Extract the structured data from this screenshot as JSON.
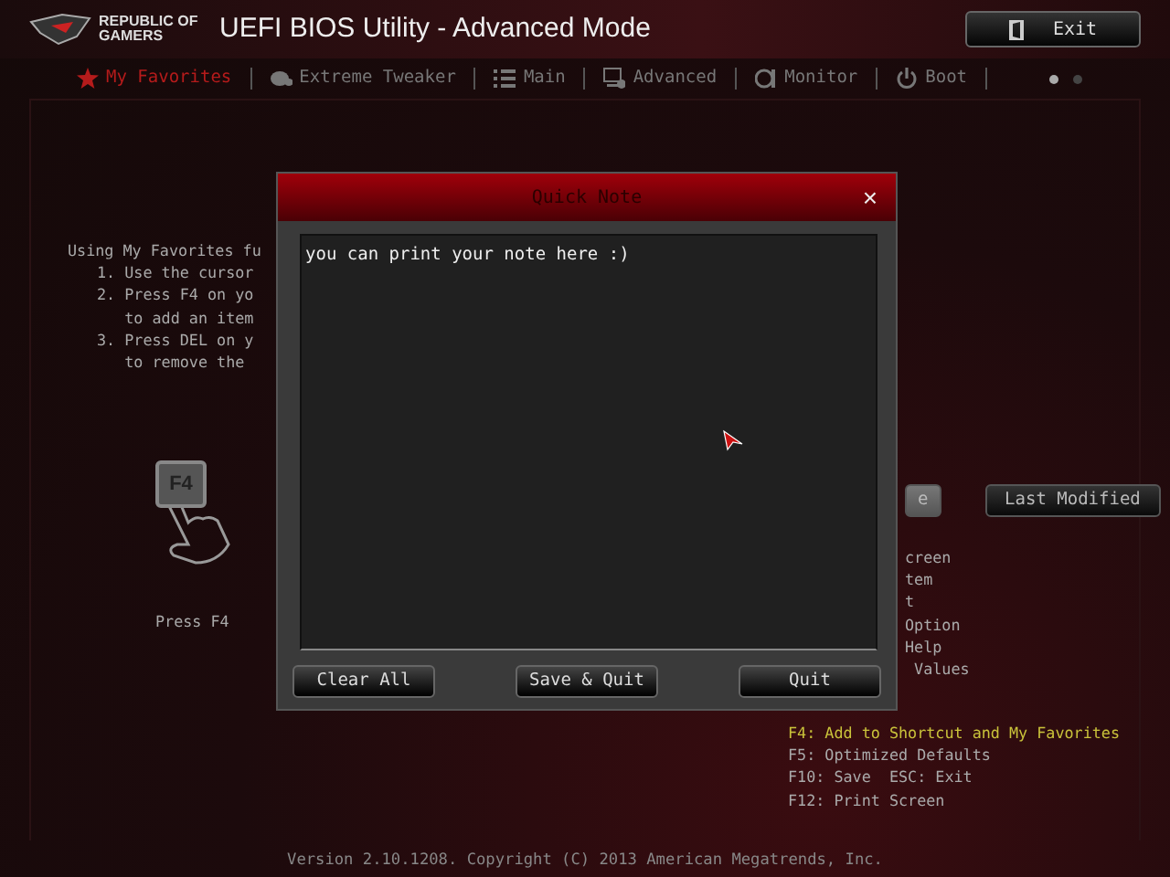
{
  "header": {
    "logo_text": "REPUBLIC OF GAMERS",
    "title": "UEFI BIOS Utility - Advanced Mode",
    "exit_button": "Exit"
  },
  "tabs": [
    {
      "label": "My Favorites",
      "selected": true
    },
    {
      "label": "Extreme Tweaker",
      "selected": false
    },
    {
      "label": "Main",
      "selected": false
    },
    {
      "label": "Advanced",
      "selected": false
    },
    {
      "label": "Monitor",
      "selected": false
    },
    {
      "label": "Boot",
      "selected": false
    }
  ],
  "pages": [
    {
      "selected": true
    },
    {
      "selected": false
    }
  ],
  "left_panel": {
    "intro": "Using My Favorites fu",
    "steps": [
      "1. Use the cursor",
      "2. Press F4 on yo",
      "   to add an item",
      "3. Press DEL on y",
      "   to remove the"
    ],
    "key": "F4",
    "caption": "Press F4"
  },
  "right_panel": {
    "buttons": [
      {
        "label": "e",
        "selected": true
      },
      {
        "label": "Last Modified",
        "selected": false
      }
    ],
    "hints": [
      "creen",
      "tem",
      "t",
      "Option",
      "Help",
      " Values"
    ]
  },
  "key_list": [
    {
      "text": "F4: Add to Shortcut and My Favorites",
      "highlighted": true
    },
    {
      "text": "F5: Optimized Defaults",
      "highlighted": false
    },
    {
      "text": "F10: Save  ESC: Exit",
      "highlighted": false
    },
    {
      "text": "F12: Print Screen",
      "highlighted": false
    }
  ],
  "dialog": {
    "title": "Quick Note",
    "close": "×",
    "note": "you can print your note here :)",
    "buttons": [
      "Clear All",
      "Save & Quit",
      "Quit"
    ]
  },
  "footer": "Version 2.10.1208. Copyright (C) 2013 American Megatrends, Inc."
}
